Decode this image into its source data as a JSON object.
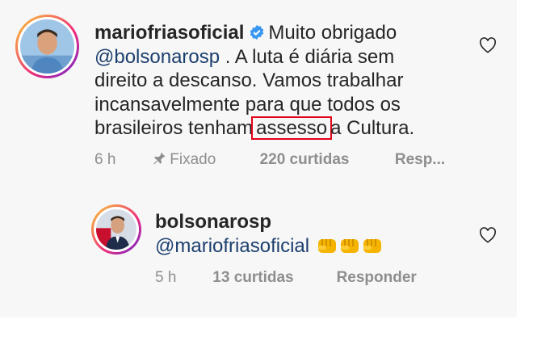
{
  "comment": {
    "username": "mariofriasoficial",
    "text_before_mention": "Muito obrigado",
    "mention": "@bolsonarosp",
    "text_line_2": ". A luta é diária sem",
    "text_line_3": "direito a descanso. Vamos trabalhar",
    "text_line_4": "incansavelmente para que todos os",
    "text_line_5_prefix": "brasileiros tenham",
    "highlighted_word": "assesso",
    "text_line_5_suffix": "a Cultura.",
    "time": "6 h",
    "pinned_label": "Fixado",
    "likes": "220 curtidas",
    "reply_label": "Resp..."
  },
  "reply": {
    "username": "bolsonarosp",
    "mention": "@mariofriasoficial",
    "emoji": "fist-emoji",
    "emoji_count": 3,
    "time": "5 h",
    "likes": "13 curtidas",
    "reply_label": "Responder"
  },
  "colors": {
    "highlight_box": "#e2001a",
    "mention": "#1c3f6e",
    "verified": "#3897f0",
    "meta": "#8e8e8e"
  }
}
